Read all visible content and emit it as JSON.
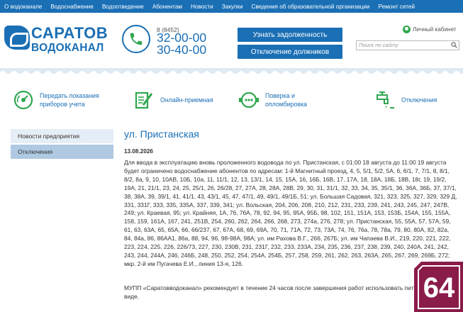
{
  "topnav": {
    "items": [
      "О водоканале",
      "Водоснабжение",
      "Водоотведение",
      "Абонентам",
      "Новости",
      "Закупки",
      "Сведения об образовательной организации",
      "Ремонт сетей"
    ]
  },
  "header": {
    "logo_line1": "САРАТОВ",
    "logo_line2": "ВОДОКАНАЛ",
    "phone_code": "8 (8452)",
    "phone1": "32-00-00",
    "phone2": "30-40-00",
    "btn_debt": "Узнать задолженность",
    "btn_disconnect": "Отключение должников",
    "cabinet": "Личный кабинет",
    "search_placeholder": "Поиск по сайту"
  },
  "services": [
    {
      "label_l1": "Передать показания",
      "label_l2": "приборов учета",
      "icon": "meter-gauge-icon"
    },
    {
      "label_l1": "Онлайн-приемная",
      "label_l2": "",
      "icon": "document-pen-icon"
    },
    {
      "label_l1": "Поверка и",
      "label_l2": "опломбировка",
      "icon": "water-meter-icon"
    },
    {
      "label_l1": "Отключения",
      "label_l2": "",
      "icon": "faucet-icon"
    }
  ],
  "sidebar": {
    "items": [
      {
        "label": "Новости предприятия"
      },
      {
        "label": "Отключения"
      }
    ]
  },
  "article": {
    "title": "ул. Пристанская",
    "date": "13.08.2026",
    "body": "Для ввода в эксплуатацию вновь проложенного водовода по ул. Пристанская, с 01:00 18 августа до 11:00 19 августа будет ограничено водоснабжение абонентов по адресам: 1-й Магнитный проезд, 4, 5, 5/1, 5/2, 5А, 6, 6/1, 7, 7/1, 8, 8/1, 8/2, 8а, 9, 10, 10АВ, 10Б, 10а, 11, 11/1, 12, 13, 13/1, 14, 15, 15А, 16, 16Б, 16В, 17, 17А, 18, 18А, 18Б, 18В, 18г, 19, 19/2, 19А, 21, 21/1, 23, 24, 25, 25/1, 26, 26/28, 27, 27А, 28, 28А, 28В, 29, 30, 31, 31/1, 32, 33, 34, 35, 35/1, 36, 36А, 36Б, 37, 37/1, 38, 38А, 39, 39/1, 41, 41/1, 43, 43/1, 45, 47, 47/1, 49, 49/1, 49/1Б, 51; ул. Большая Садовая, 321, 323, 325, 327, 329, 329 Д, 331, 331Г, 333, 335, 335А, 337, 339, 341; ул. Вольская, 204, 206, 208, 210, 212, 231, 233, 239, 241, 243, 245, 247, 247В, 249; ул. Краевая, 95; ул. Крайняя, 1А, 76, 76А, 78, 92, 94, 95, 95А, 95Б, 98, 102, 151, 151А, 153, 153Б, 154А, 155, 155А, 158, 159, 161А, 167, 241, 251В, 254, 260, 262, 264, 266, 268, 273, 274а, 276, 278; ул. Пристанская, 55, 55А, 57, 57А, 59, 61, 63, 63А, 65, 65А, 66, 66/237, 67, 67А, 68, 69, 69А, 70, 71, 71А, 72, 73, 73А, 74, 76, 76а, 78, 78а, 79, 80, 80А, 82, 82а, 84, 84а, 86, 86АА1, 86а, 88, 94, 96, 98-98А, 98А; ул. им Рахова В.Г., 266, 267Б; ул. им Чапаева В.И., 219, 220, 221, 222, 223, 224, 225, 226, 226/73, 227, 230, 230В, 231, 231Г, 232, 233, 233А, 234, 235, 236, 237, 238, 239, 240, 240А, 241, 242, 243, 244, 244А, 246, 246Б, 248, 250, 252, 254, 254А, 254Б, 257, 258, 259, 261, 262, 263, 263А, 265, 267, 269, 269Б, 272; мкр. 2-й им Пугачева Е.И., линия 13-я, 126.",
    "note": "МУПП «Саратовводоканал» рекомендует в течение 24 часов после завершения работ использовать пит кипяченом виде."
  },
  "badge": {
    "text": "64"
  },
  "colors": {
    "brand": "#1a6fb5",
    "sidebar_active": "#aec9e1",
    "sidebar_bg": "#e5eef6",
    "service_green": "#2fa84f",
    "badge": "#8a1c4a"
  }
}
